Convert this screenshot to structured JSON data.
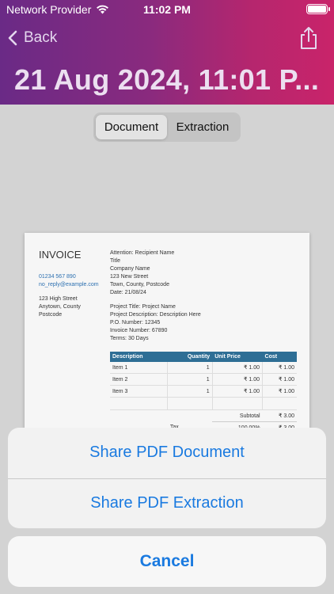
{
  "status_bar": {
    "carrier": "Network Provider",
    "time": "11:02 PM"
  },
  "nav": {
    "back_label": "Back",
    "title": "21 Aug 2024, 11:01 P..."
  },
  "segmented": {
    "items": [
      "Document",
      "Extraction"
    ],
    "selected": "Document"
  },
  "invoice": {
    "heading": "INVOICE",
    "phone": "01234 567 890",
    "email": "no_reply@example.com",
    "address": [
      "123 High Street",
      "Anytown, County",
      "Postcode"
    ],
    "attention": [
      "Attention: Recipient Name",
      "Title",
      "Company Name",
      "123 New Street",
      "Town, County, Postcode",
      "Date: 21/08/24"
    ],
    "project": [
      "Project Title: Project Name",
      "Project Description: Description Here",
      "P.O. Number: 12345",
      "Invoice Number: 67890",
      "Terms: 30 Days"
    ],
    "table": {
      "headers": [
        "Description",
        "Quantity",
        "Unit Price",
        "Cost"
      ],
      "rows": [
        [
          "Item 1",
          "1",
          "₹ 1.00",
          "₹ 1.00"
        ],
        [
          "Item 2",
          "1",
          "₹ 1.00",
          "₹ 1.00"
        ],
        [
          "Item 3",
          "1",
          "₹ 1.00",
          "₹ 1.00"
        ]
      ],
      "subtotal_label": "Subtotal",
      "subtotal_value": "₹ 3.00",
      "tax_label": "Tax",
      "tax_rate": "100.00%",
      "tax_value": "₹ 3.00"
    }
  },
  "action_sheet": {
    "items": [
      "Share PDF Document",
      "Share PDF Extraction"
    ],
    "cancel_label": "Cancel"
  },
  "colors": {
    "accent": "#1a7ae0",
    "header_start": "#6a2a86",
    "header_end": "#c9246a",
    "table_header": "#2e6e95"
  },
  "icons": [
    "wifi-icon",
    "battery-icon",
    "chevron-left-icon",
    "share-icon"
  ]
}
